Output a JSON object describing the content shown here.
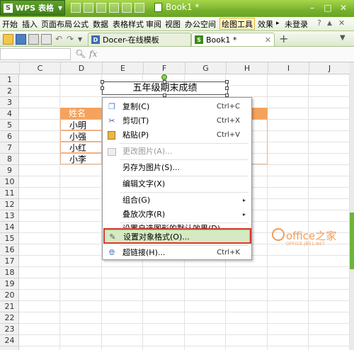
{
  "titlebar": {
    "app_name": "WPS 表格",
    "app_logo_letter": "S",
    "document_title": "Book1 *"
  },
  "menu": {
    "items": [
      "开始",
      "插入",
      "页面布局",
      "公式",
      "数据",
      "表格样式",
      "审阅",
      "视图",
      "办公空间",
      "绘图工具",
      "效果"
    ],
    "login": "未登录"
  },
  "tabs": [
    {
      "label": "Docer-在线模板",
      "icon_letter": "D",
      "color": "#3a6db5"
    },
    {
      "label": "Book1 *",
      "icon_letter": "S",
      "color": "#3c8a16"
    }
  ],
  "formula": {
    "fx_label": "fx",
    "name_box_value": ""
  },
  "columns": [
    "C",
    "D",
    "E",
    "F",
    "G",
    "H",
    "I",
    "J"
  ],
  "rows": [
    "1",
    "2",
    "3",
    "4",
    "5",
    "6",
    "7",
    "8",
    "9",
    "10",
    "11",
    "12",
    "13",
    "14",
    "15",
    "16",
    "17",
    "18",
    "19",
    "20",
    "21",
    "22",
    "23",
    "24"
  ],
  "sheet": {
    "title_text": "五年级期末成绩",
    "header_cell": "姓名",
    "names": [
      "小明",
      "小强",
      "小红",
      "小李"
    ]
  },
  "context_menu": {
    "items": [
      {
        "label": "复制(C)",
        "shortcut": "Ctrl+C",
        "icon": "copy-icon"
      },
      {
        "label": "剪切(T)",
        "shortcut": "Ctrl+X",
        "icon": "scissors-icon"
      },
      {
        "label": "粘贴(P)",
        "shortcut": "Ctrl+V",
        "icon": "paste-icon"
      },
      {
        "label": "更改图片(A)...",
        "shortcut": "",
        "icon": "picture-icon",
        "disabled": true
      },
      {
        "label": "另存为图片(S)...",
        "shortcut": ""
      },
      {
        "label": "编辑文字(X)",
        "shortcut": ""
      },
      {
        "label": "组合(G)",
        "shortcut": "",
        "submenu": "▸"
      },
      {
        "label": "叠放次序(R)",
        "shortcut": "",
        "submenu": "▸"
      },
      {
        "label": "设置自选图形的默认效果(D)",
        "shortcut": ""
      },
      {
        "label": "设置对象格式(O)...",
        "shortcut": "",
        "icon": "format-object-icon"
      },
      {
        "label": "超链接(H)...",
        "shortcut": "Ctrl+K",
        "icon": "hyperlink-icon"
      }
    ]
  },
  "watermark": {
    "main": "office之家",
    "sub": "OFFICE.JB51.NET"
  },
  "colors": {
    "accent_green": "#76b22c",
    "header_orange": "#f5a25d",
    "highlight_red": "#d83a2d"
  }
}
